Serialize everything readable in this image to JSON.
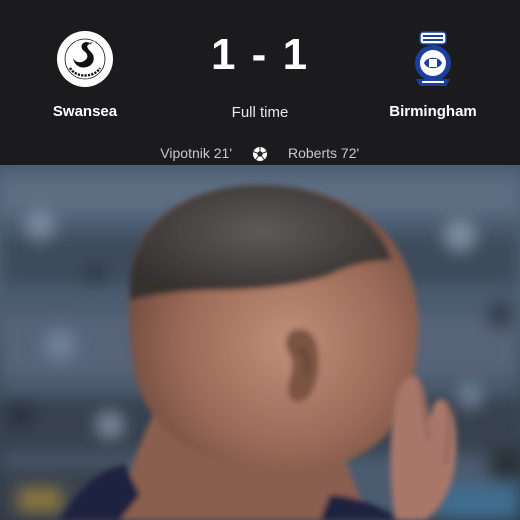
{
  "match": {
    "home_team": "Swansea",
    "away_team": "Birmingham",
    "home_score": "1",
    "separator": "-",
    "away_score": "1",
    "status": "Full time"
  },
  "scorers": {
    "home": "Vipotnik 21'",
    "away": "Roberts 72'"
  },
  "icons": {
    "home_crest": "swansea-city-crest",
    "away_crest": "birmingham-city-crest",
    "goal": "football-icon"
  },
  "colors": {
    "background": "#1b1b1d",
    "text": "#ffffff",
    "muted": "#c9c9c9",
    "birmingham_blue": "#1b3f9c"
  }
}
